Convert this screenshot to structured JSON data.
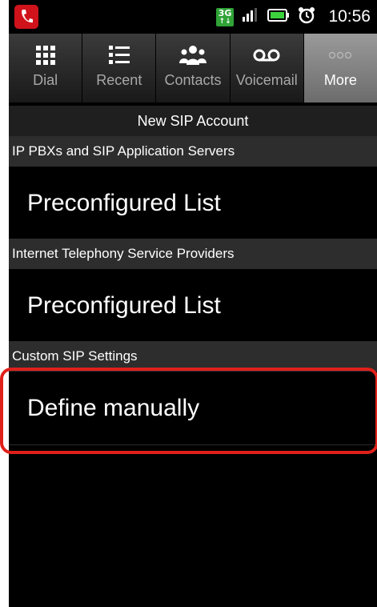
{
  "status_bar": {
    "network_badge": "3G",
    "time": "10:56",
    "app_icon": "phone-handset-icon",
    "icons": [
      "signal-bars-icon",
      "battery-icon",
      "alarm-clock-icon"
    ]
  },
  "tabs": [
    {
      "label": "Dial",
      "icon": "keypad-icon"
    },
    {
      "label": "Recent",
      "icon": "list-icon"
    },
    {
      "label": "Contacts",
      "icon": "contacts-icon"
    },
    {
      "label": "Voicemail",
      "icon": "voicemail-icon"
    },
    {
      "label": "More",
      "icon": "more-icon",
      "active": true
    }
  ],
  "title": "New SIP Account",
  "sections": [
    {
      "header": "IP PBXs and SIP Application Servers",
      "item": "Preconfigured List"
    },
    {
      "header": "Internet Telephony Service Providers",
      "item": "Preconfigured List"
    },
    {
      "header": "Custom SIP Settings",
      "item": "Define manually"
    }
  ],
  "colors": {
    "highlight": "#e0201a",
    "badge": "#2fa336",
    "app_icon": "#d0131b"
  }
}
